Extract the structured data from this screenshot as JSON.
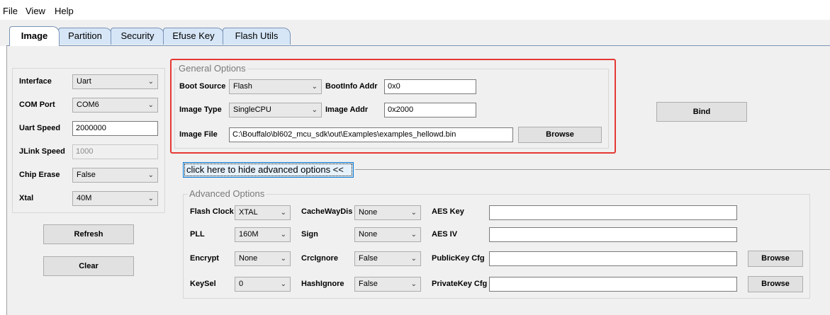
{
  "menu": {
    "file": "File",
    "view": "View",
    "help": "Help"
  },
  "tabs": [
    "Image",
    "Partition",
    "Security",
    "Efuse Key",
    "Flash Utils"
  ],
  "left": {
    "interface_label": "Interface",
    "interface_value": "Uart",
    "com_label": "COM Port",
    "com_value": "COM6",
    "uart_speed_label": "Uart Speed",
    "uart_speed_value": "2000000",
    "jlink_speed_label": "JLink Speed",
    "jlink_speed_value": "1000",
    "chip_erase_label": "Chip Erase",
    "chip_erase_value": "False",
    "xtal_label": "Xtal",
    "xtal_value": "40M",
    "refresh_label": "Refresh",
    "clear_label": "Clear"
  },
  "general": {
    "title": "General Options",
    "boot_source_label": "Boot Source",
    "boot_source_value": "Flash",
    "bootinfo_addr_label": "BootInfo Addr",
    "bootinfo_addr_value": "0x0",
    "image_type_label": "Image Type",
    "image_type_value": "SingleCPU",
    "image_addr_label": "Image Addr",
    "image_addr_value": "0x2000",
    "image_file_label": "Image File",
    "image_file_value": "C:\\Bouffalo\\bl602_mcu_sdk\\out\\Examples\\examples_hellowd.bin",
    "browse_label": "Browse"
  },
  "bind_label": "Bind",
  "toggle_label": "click here to hide advanced options <<",
  "advanced": {
    "title": "Advanced Options",
    "flash_clock_label": "Flash Clock",
    "flash_clock_value": "XTAL",
    "cachewaydis_label": "CacheWayDis",
    "cachewaydis_value": "None",
    "aes_key_label": "AES Key",
    "aes_key_value": "",
    "pll_label": "PLL",
    "pll_value": "160M",
    "sign_label": "Sign",
    "sign_value": "None",
    "aes_iv_label": "AES IV",
    "aes_iv_value": "",
    "encrypt_label": "Encrypt",
    "encrypt_value": "None",
    "crcignore_label": "CrcIgnore",
    "crcignore_value": "False",
    "publickey_label": "PublicKey Cfg",
    "publickey_value": "",
    "keysel_label": "KeySel",
    "keysel_value": "0",
    "hashignore_label": "HashIgnore",
    "hashignore_value": "False",
    "privatekey_label": "PrivateKey Cfg",
    "privatekey_value": "",
    "browse_label": "Browse"
  },
  "icons": {
    "dropdown": "chevron-down-icon"
  },
  "colors": {
    "highlight": "#e53935",
    "accent": "#0078d7",
    "tab_fill": "#d6e6f7"
  }
}
